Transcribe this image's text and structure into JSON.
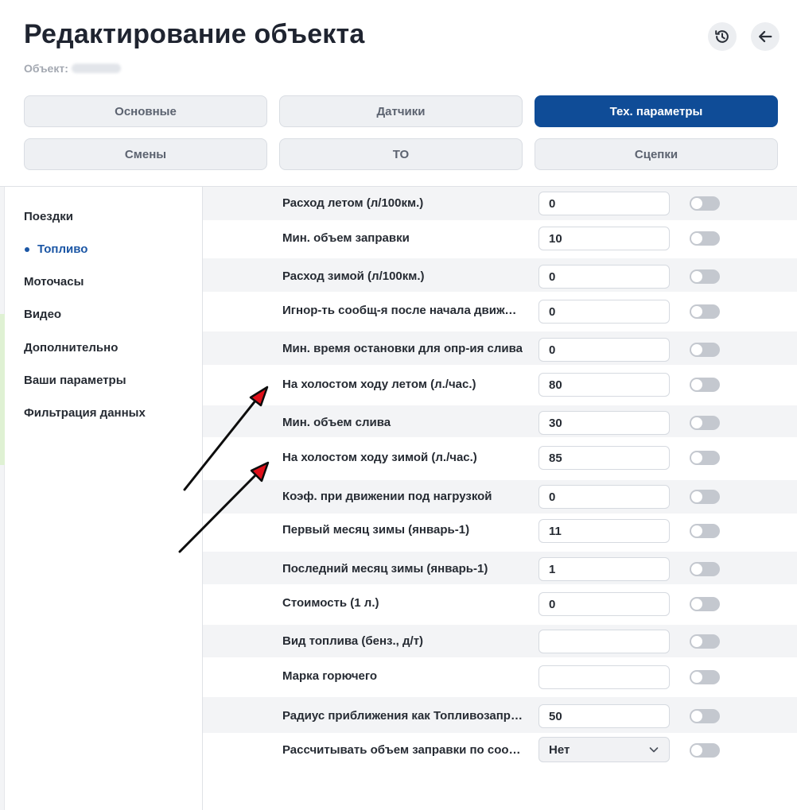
{
  "header": {
    "title": "Редактирование объекта",
    "subtitle_label": "Объект:"
  },
  "icons": {
    "history": "history-icon",
    "back": "arrow-left-icon"
  },
  "tabs": [
    {
      "label": "Основные",
      "active": false
    },
    {
      "label": "Датчики",
      "active": false
    },
    {
      "label": "Тех. параметры",
      "active": true
    },
    {
      "label": "Смены",
      "active": false
    },
    {
      "label": "ТО",
      "active": false
    },
    {
      "label": "Сцепки",
      "active": false
    }
  ],
  "sidebar": {
    "items": [
      {
        "label": "Поездки",
        "active": false
      },
      {
        "label": "Топливо",
        "active": true
      },
      {
        "label": "Моточасы",
        "active": false
      },
      {
        "label": "Видео",
        "active": false
      },
      {
        "label": "Дополнительно",
        "active": false
      },
      {
        "label": "Ваши параметры",
        "active": false
      },
      {
        "label": "Фильтрация данных",
        "active": false
      }
    ]
  },
  "params": [
    {
      "label": "Расход летом (л/100км.)",
      "value": "0",
      "enabled": false
    },
    {
      "label": "Мин. объем заправки",
      "value": "10",
      "enabled": false
    },
    {
      "label": "Расход зимой (л/100км.)",
      "value": "0",
      "enabled": false
    },
    {
      "label": "Игнор-ть сообщ-я после начала движения",
      "value": "0",
      "enabled": false
    },
    {
      "label": "Мин. время остановки для опр-ия слива",
      "value": "0",
      "enabled": false
    },
    {
      "label": "На холостом ходу летом (л./час.)",
      "value": "80",
      "enabled": false
    },
    {
      "label": "Мин. объем слива",
      "value": "30",
      "enabled": false
    },
    {
      "label": "На холостом ходу зимой (л./час.)",
      "value": "85",
      "enabled": false
    },
    {
      "label": "Коэф. при движении под нагрузкой",
      "value": "0",
      "enabled": false
    },
    {
      "label": "Первый месяц зимы (январь-1)",
      "value": "11",
      "enabled": false
    },
    {
      "label": "Последний месяц зимы (январь-1)",
      "value": "1",
      "enabled": false
    },
    {
      "label": "Стоимость (1 л.)",
      "value": "0",
      "enabled": false
    },
    {
      "label": "Вид топлива (бенз., д/т)",
      "value": "",
      "enabled": false
    },
    {
      "label": "Марка горючего",
      "value": "",
      "enabled": false
    },
    {
      "label": "Радиус приближения как Топливозаправщика",
      "value": "50",
      "enabled": false
    },
    {
      "label": "Рассчитывать объем заправки по сообщениям",
      "value": "Нет",
      "enabled": false,
      "type": "select"
    }
  ],
  "colors": {
    "accent": "#0f4c97",
    "arrow_head": "#e0101a"
  }
}
